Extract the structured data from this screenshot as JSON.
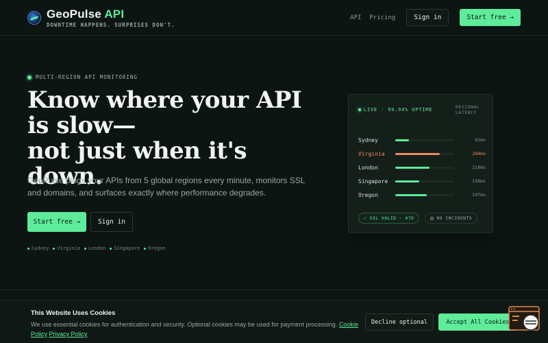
{
  "nav": {
    "brand_main": "GeoPulse",
    "brand_accent": "API",
    "tagline": "DOWNTIME HAPPENS. SURPRISES DON'T.",
    "links": [
      "API",
      "Pricing"
    ],
    "sign_in": "Sign in",
    "start_free": "Start free →"
  },
  "hero": {
    "eyebrow": "MULTI-REGION API MONITORING",
    "headline_line1": "Know where your API is slow—",
    "headline_line2": "not just when it's down.",
    "subtext": "GeoPulse pings your APIs from 5 global regions every minute, monitors SSL and domains, and surfaces exactly where performance degrades.",
    "cta_primary": "Start free →",
    "cta_secondary": "Sign in",
    "regions": [
      "Sydney",
      "Virginia",
      "London",
      "Singapore",
      "Oregon"
    ]
  },
  "card": {
    "status": "LIVE · 99.94% UPTIME",
    "latency_label": "REGIONAL LATENCY",
    "rows": [
      {
        "name": "Sydney",
        "value": "92ms",
        "level": 0.23,
        "warn": false
      },
      {
        "name": "Virginia",
        "value": "284ms",
        "level": 0.76,
        "warn": true
      },
      {
        "name": "London",
        "value": "218ms",
        "level": 0.58,
        "warn": false
      },
      {
        "name": "Singapore",
        "value": "156ms",
        "level": 0.41,
        "warn": false
      },
      {
        "name": "Oregon",
        "value": "197ms",
        "level": 0.53,
        "warn": false
      }
    ],
    "ssl_pill": "✓ SSL VALID · 47D",
    "incidents_pill": "NO INCIDENTS"
  },
  "cookie": {
    "title": "This Website Uses Cookies",
    "text": "We use essential cookies for authentication and security. Optional cookies may be used for payment processing.",
    "link_cookie": "Cookie Policy",
    "link_privacy": "Privacy Policy",
    "decline": "Decline optional",
    "accept": "Accept All Cookies"
  },
  "colors": {
    "accent": "#5eeb9a",
    "warning": "#f08a5d",
    "background": "#0d1512"
  }
}
